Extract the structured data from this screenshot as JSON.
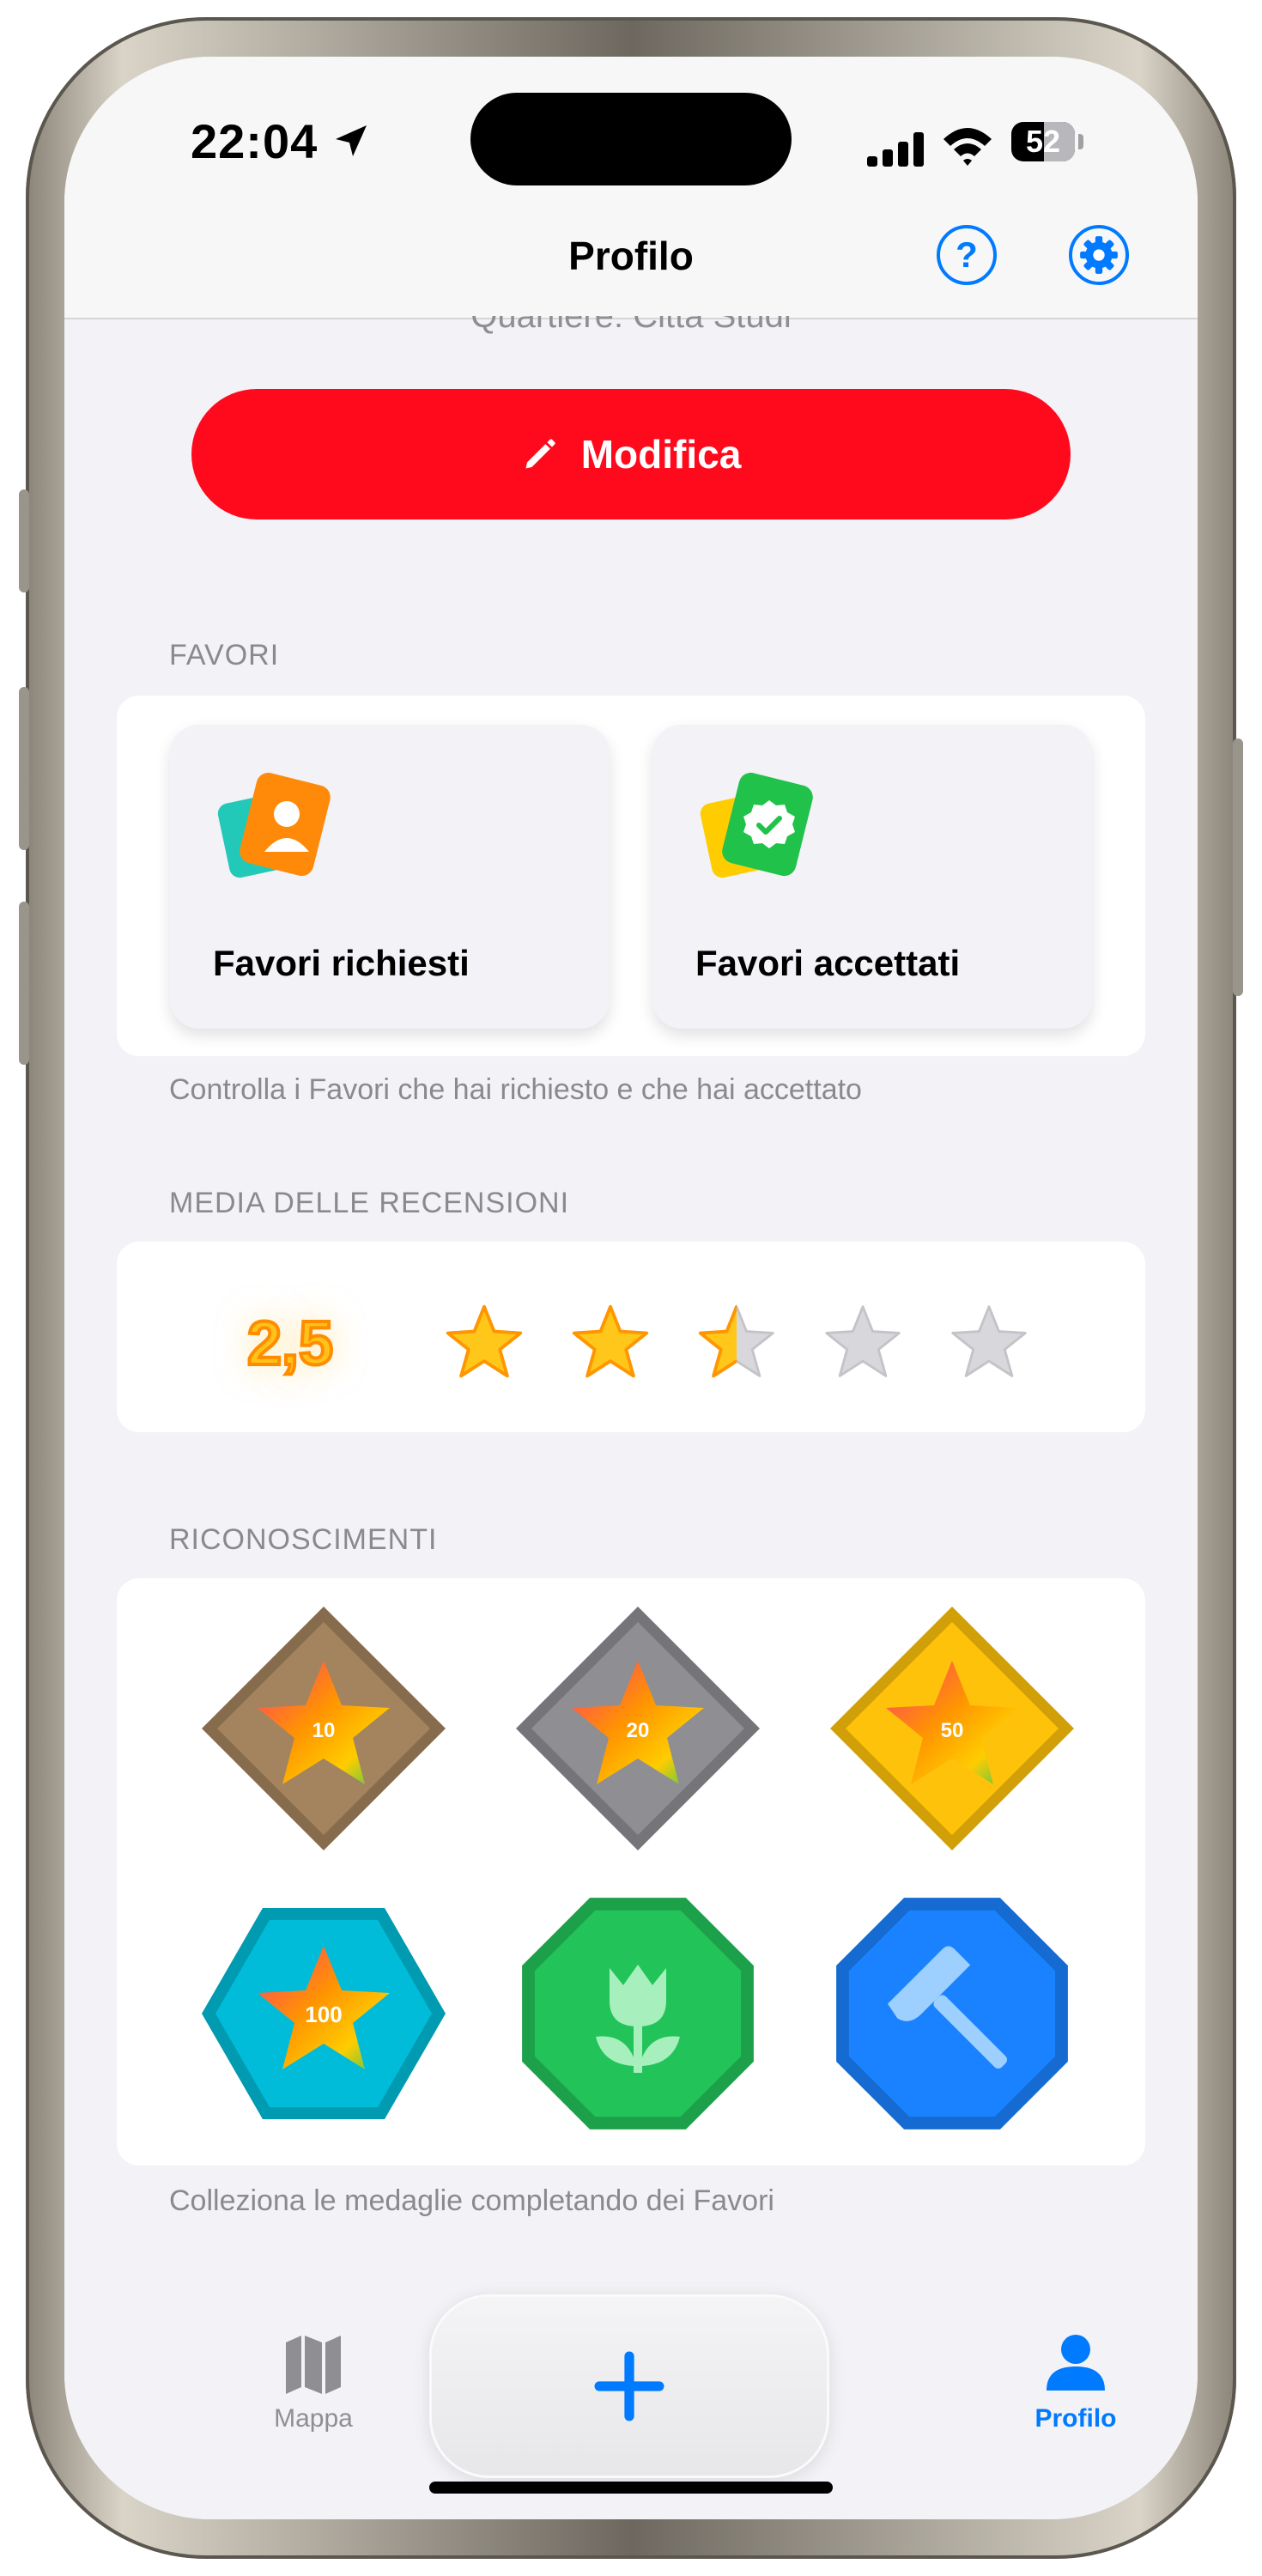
{
  "status_bar": {
    "time": "22:04",
    "battery": "52",
    "battery_level_percent": 52,
    "icons": [
      "location-arrow-icon",
      "cellular-signal-icon",
      "wifi-icon",
      "battery-icon"
    ]
  },
  "nav": {
    "title": "Profilo",
    "help_icon": "question-mark-circle-icon",
    "help_glyph": "?",
    "settings_icon": "gear-icon",
    "scrolled_text": "Quartiere: Città Studi"
  },
  "edit_button": {
    "label": "Modifica",
    "icon": "pencil-icon",
    "color": "#ff0a1c"
  },
  "favors": {
    "header": "FAVORI",
    "requested_label": "Favori richiesti",
    "accepted_label": "Favori accettati",
    "footer": "Controlla i Favori che hai richiesto e che hai accettato"
  },
  "reviews": {
    "header": "MEDIA DELLE RECENSIONI",
    "average": "2,5",
    "rating_value": 2.5,
    "rating_max": 5
  },
  "achievements": {
    "header": "RICONOSCIMENTI",
    "footer": "Colleziona le medaglie completando dei Favori",
    "badges": [
      {
        "label": "10",
        "shape": "diamond",
        "color": "#a4845e"
      },
      {
        "label": "20",
        "shape": "diamond",
        "color": "#8e8e93"
      },
      {
        "label": "50",
        "shape": "diamond",
        "color": "#ffc20a"
      },
      {
        "label": "100",
        "shape": "hexagon",
        "color": "#00bcd8"
      },
      {
        "label": "",
        "shape": "octagon",
        "color": "#22c45a",
        "icon": "tulip-icon"
      },
      {
        "label": "",
        "shape": "octagon",
        "color": "#1a82ff",
        "icon": "hammer-icon"
      }
    ]
  },
  "tab_bar": {
    "map_label": "Mappa",
    "profile_label": "Profilo",
    "accent": "#007aff",
    "icons": [
      "map-icon",
      "plus-icon",
      "person-icon"
    ]
  }
}
